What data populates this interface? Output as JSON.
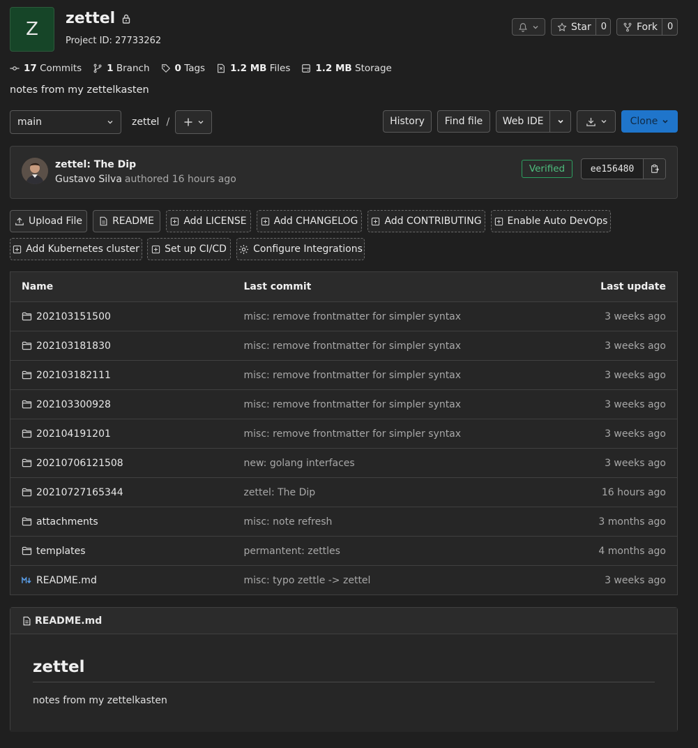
{
  "project": {
    "avatar_letter": "Z",
    "name": "zettel",
    "id_label": "Project ID: 27733262",
    "description": "notes from my zettelkasten"
  },
  "actions": {
    "star_label": "Star",
    "star_count": "0",
    "fork_label": "Fork",
    "fork_count": "0"
  },
  "stats": {
    "commits_num": "17",
    "commits_label": "Commits",
    "branch_num": "1",
    "branch_label": "Branch",
    "tags_num": "0",
    "tags_label": "Tags",
    "files_num": "1.2 MB",
    "files_label": "Files",
    "storage_num": "1.2 MB",
    "storage_label": "Storage"
  },
  "toolbar": {
    "branch": "main",
    "path": "zettel",
    "path_sep": "/",
    "history": "History",
    "find_file": "Find file",
    "web_ide": "Web IDE",
    "clone": "Clone"
  },
  "last_commit": {
    "title": "zettel: The Dip",
    "author": "Gustavo Silva",
    "meta": "authored 16 hours ago",
    "verified": "Verified",
    "sha": "ee156480"
  },
  "quick_actions": {
    "upload_file": "Upload File",
    "readme": "README",
    "add_license": "Add LICENSE",
    "add_changelog": "Add CHANGELOG",
    "add_contributing": "Add CONTRIBUTING",
    "enable_auto_devops": "Enable Auto DevOps",
    "add_kubernetes": "Add Kubernetes cluster",
    "setup_cicd": "Set up CI/CD",
    "configure_integrations": "Configure Integrations"
  },
  "file_table": {
    "headers": {
      "name": "Name",
      "last_commit": "Last commit",
      "last_update": "Last update"
    },
    "rows": [
      {
        "type": "folder",
        "name": "202103151500",
        "commit": "misc: remove frontmatter for simpler syntax",
        "updated": "3 weeks ago"
      },
      {
        "type": "folder",
        "name": "202103181830",
        "commit": "misc: remove frontmatter for simpler syntax",
        "updated": "3 weeks ago"
      },
      {
        "type": "folder",
        "name": "202103182111",
        "commit": "misc: remove frontmatter for simpler syntax",
        "updated": "3 weeks ago"
      },
      {
        "type": "folder",
        "name": "202103300928",
        "commit": "misc: remove frontmatter for simpler syntax",
        "updated": "3 weeks ago"
      },
      {
        "type": "folder",
        "name": "202104191201",
        "commit": "misc: remove frontmatter for simpler syntax",
        "updated": "3 weeks ago"
      },
      {
        "type": "folder",
        "name": "20210706121508",
        "commit": "new: golang interfaces",
        "updated": "3 weeks ago"
      },
      {
        "type": "folder",
        "name": "20210727165344",
        "commit": "zettel: The Dip",
        "updated": "16 hours ago"
      },
      {
        "type": "folder",
        "name": "attachments",
        "commit": "misc: note refresh",
        "updated": "3 months ago"
      },
      {
        "type": "folder",
        "name": "templates",
        "commit": "permantent: zettles",
        "updated": "4 months ago"
      },
      {
        "type": "markdown",
        "name": "README.md",
        "commit": "misc: typo zettle -> zettel",
        "updated": "3 weeks ago"
      }
    ]
  },
  "readme": {
    "file_name": "README.md",
    "heading": "zettel",
    "body": "notes from my zettelkasten"
  },
  "colors": {
    "background": "#1f1f1f",
    "avatar_bg": "#164528",
    "clone_button": "#1f75cb",
    "verified": "#2da160"
  }
}
